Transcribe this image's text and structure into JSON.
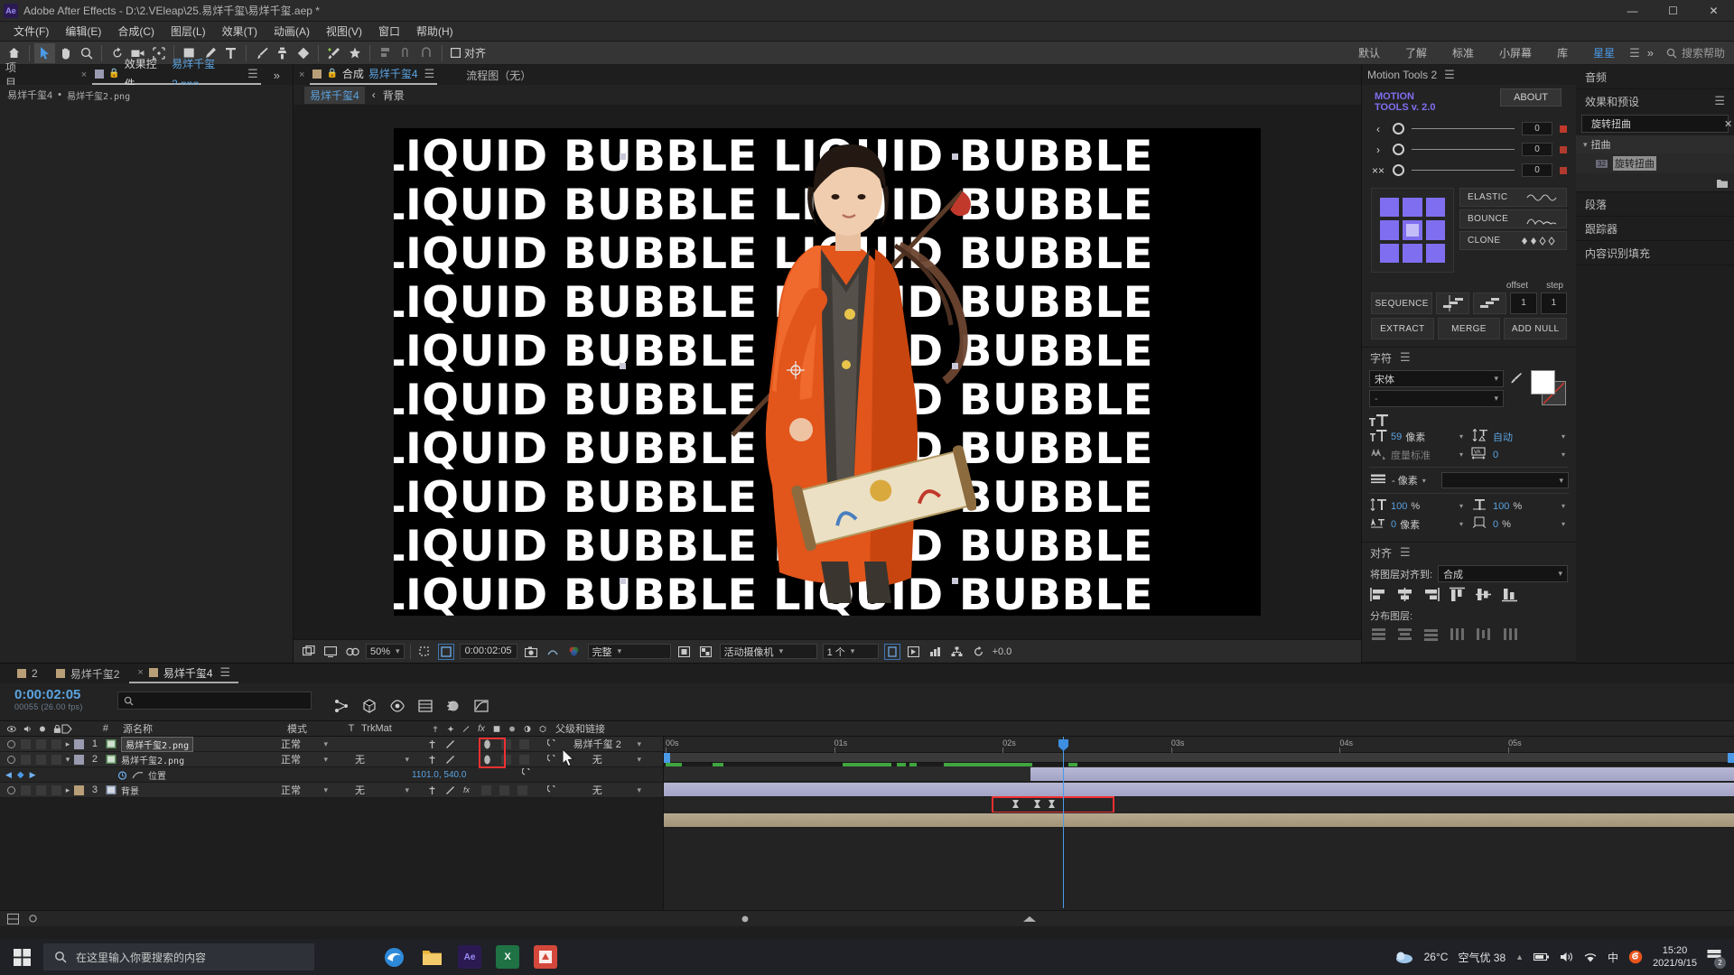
{
  "titlebar": {
    "app_badge": "Ae",
    "title": "Adobe After Effects - D:\\2.VEleap\\25.易烊千玺\\易烊千玺.aep *",
    "minimize": "—",
    "maximize": "☐",
    "close": "✕"
  },
  "menu": [
    {
      "label": "文件(F)"
    },
    {
      "label": "编辑(E)"
    },
    {
      "label": "合成(C)"
    },
    {
      "label": "图层(L)"
    },
    {
      "label": "效果(T)"
    },
    {
      "label": "动画(A)"
    },
    {
      "label": "视图(V)"
    },
    {
      "label": "窗口"
    },
    {
      "label": "帮助(H)"
    }
  ],
  "toolbar": {
    "align_label": "对齐",
    "tools": [
      {
        "name": "home-icon",
        "glyph": "⌂"
      },
      {
        "name": "selection-tool-icon",
        "glyph": "▶"
      },
      {
        "name": "hand-tool-icon",
        "glyph": "✋"
      },
      {
        "name": "zoom-tool-icon",
        "glyph": "⌕"
      },
      {
        "name": "rotation-tool-icon",
        "glyph": "↺"
      },
      {
        "name": "camera-tool-icon",
        "glyph": "🎥"
      },
      {
        "name": "anchor-point-tool-icon",
        "glyph": "✣"
      },
      {
        "name": "shape-tool-icon",
        "glyph": "■"
      },
      {
        "name": "pen-tool-icon",
        "glyph": "✒"
      },
      {
        "name": "type-tool-icon",
        "glyph": "T"
      },
      {
        "name": "brush-tool-icon",
        "glyph": "✐"
      },
      {
        "name": "clone-stamp-tool-icon",
        "glyph": "⚑"
      },
      {
        "name": "eraser-tool-icon",
        "glyph": "◆"
      },
      {
        "name": "roto-brush-tool-icon",
        "glyph": "✨"
      },
      {
        "name": "puppet-tool-icon",
        "glyph": "✶"
      }
    ],
    "workspaces": [
      {
        "label": "默认",
        "active": false
      },
      {
        "label": "了解",
        "active": false
      },
      {
        "label": "标准",
        "active": false
      },
      {
        "label": "小屏幕",
        "active": false
      },
      {
        "label": "库",
        "active": false
      },
      {
        "label": "星星",
        "active": true
      }
    ],
    "workspace_more": "»",
    "search_placeholder": "搜索帮助"
  },
  "project_panel": {
    "tab_project": "项目",
    "tab_effect_controls": "效果控件",
    "effect_controls_target": "易烊千玺2.png",
    "overflow": "»",
    "breadcrumb_comp": "易烊千玺4",
    "breadcrumb_sep": "•",
    "breadcrumb_layer": "易烊千玺2.png"
  },
  "comp_panel": {
    "tab_label": "合成",
    "tab_comp_name": "易烊千玺4",
    "flowchart_tab": "流程图（无）",
    "breadcrumb_active": "易烊千玺4",
    "breadcrumb_chev": "‹",
    "breadcrumb_layer": "背景",
    "canvas": {
      "text_line": "LIQUID BUBBLE LIQUID BUBBLE",
      "rows": 10,
      "bg_color": "#000000",
      "text_color": "#ffffff"
    },
    "controls": {
      "zoom": "50%",
      "time": "0:00:02:05",
      "quality": "完整",
      "camera": "活动摄像机",
      "views": "1 个",
      "exposure": "+0.0"
    }
  },
  "motion_tools": {
    "panel_title": "Motion Tools 2",
    "logo_line1": "MOTION",
    "logo_line2": "TOOLS v. 2.0",
    "about": "ABOUT",
    "sliders": [
      {
        "arrow": "‹",
        "value": "0"
      },
      {
        "arrow": "›",
        "value": "0"
      },
      {
        "arrow": "××",
        "value": "0"
      }
    ],
    "elastic": "ELASTIC",
    "bounce": "BOUNCE",
    "clone": "CLONE",
    "offset_label": "offset",
    "step_label": "step",
    "sequence": "SEQUENCE",
    "offset_value": "1",
    "step_value": "1",
    "extract": "EXTRACT",
    "merge": "MERGE",
    "add_null": "ADD NULL",
    "accent_color": "#7f6ef0"
  },
  "character_panel": {
    "title": "字符",
    "font_family": "宋体",
    "font_style": "-",
    "font_size": "59",
    "size_unit": "像素",
    "leading": "自动",
    "kerning": "度量标准",
    "tracking": "0",
    "baseline_row_label": "- 像素",
    "vertical_scale": "100",
    "horizontal_scale": "100",
    "vertical_unit": "%",
    "horizontal_unit": "%",
    "baseline_shift": "0",
    "baseline_unit": "像素",
    "tsume": "0",
    "tsume_unit": "%"
  },
  "align_panel": {
    "title": "对齐",
    "align_to_label": "将图层对齐到:",
    "align_to_value": "合成",
    "distribute_label": "分布图层:"
  },
  "far_right": {
    "audio_title": "音频",
    "effects_title": "效果和预设",
    "search_value": "旋转扭曲",
    "search_clear": "✕",
    "category": "扭曲",
    "effect_badge": "32",
    "effect_name": "旋转扭曲",
    "paragraph_title": "段落",
    "tracker_title": "跟踪器",
    "content_aware_title": "内容识别填充"
  },
  "timeline": {
    "tabs": [
      {
        "label": "2",
        "active": false,
        "closable": false
      },
      {
        "label": "易烊千玺2",
        "active": false,
        "closable": false
      },
      {
        "label": "易烊千玺4",
        "active": true,
        "closable": true
      }
    ],
    "current_time": "0:00:02:05",
    "frame_info": "00055 (26.00 fps)",
    "search_placeholder": "",
    "columns": {
      "num": "#",
      "source_name": "源名称",
      "mode": "模式",
      "t": "T",
      "trkmat": "TrkMat",
      "parent": "父级和链接"
    },
    "layers": [
      {
        "index": "1",
        "name": "易烊千玺2.png",
        "mode": "正常",
        "trkmat": "",
        "parent": "易烊千玺 2",
        "color": "#9a9ab0",
        "selected": true,
        "expanded": false
      },
      {
        "index": "2",
        "name": "易烊千玺2.png",
        "mode": "正常",
        "trkmat": "无",
        "parent": "无",
        "color": "#9a9ab0",
        "selected": false,
        "expanded": true
      },
      {
        "index": "3",
        "name": "背景",
        "mode": "正常",
        "trkmat": "无",
        "parent": "无",
        "color": "#b99f77",
        "selected": false,
        "expanded": false
      }
    ],
    "property": {
      "name": "位置",
      "value": "1101.0, 540.0",
      "keyframe_count": 3
    },
    "ruler_ticks": [
      "00s",
      "01s",
      "02s",
      "03s",
      "04s",
      "05s"
    ]
  },
  "taskbar": {
    "search_placeholder": "在这里输入你要搜索的内容",
    "apps": [
      {
        "name": "edge",
        "letter": "e",
        "color": "#2a7fd4"
      },
      {
        "name": "file-explorer",
        "letter": "🗀",
        "color": "#e8b23a"
      },
      {
        "name": "after-effects",
        "letter": "Ae",
        "color": "#2b1a52"
      },
      {
        "name": "excel",
        "letter": "X",
        "color": "#1f7244"
      },
      {
        "name": "editor",
        "letter": "■",
        "color": "#d4483b"
      }
    ],
    "weather_temp": "26°C",
    "weather_air": "空气优 38",
    "ime": "中",
    "time": "15:20",
    "date": "2021/9/15",
    "notification_count": "2"
  }
}
